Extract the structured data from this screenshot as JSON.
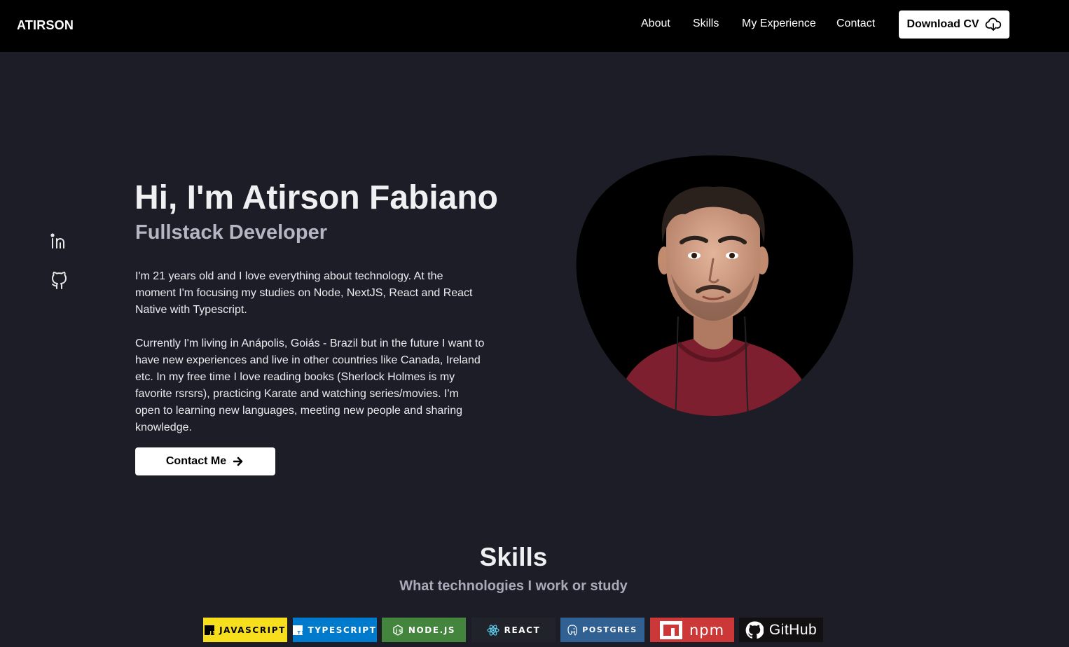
{
  "nav": {
    "brand": "ATIRSON",
    "links": [
      "About",
      "Skills",
      "My Experience",
      "Contact"
    ],
    "download_label": "Download CV"
  },
  "social": {
    "linkedin_icon": "linkedin-icon",
    "github_icon": "github-icon"
  },
  "hero": {
    "title": "Hi, I'm Atirson Fabiano",
    "subtitle": "Fullstack Developer",
    "bio_1": "I'm 21 years old and I love everything about technology. At the moment I'm focusing my studies on Node, NextJS, React and React Native with Typescript.",
    "bio_2": "Currently I'm living in Anápolis, Goiás - Brazil but in the future I want to have new experiences and live in other countries like Canada, Ireland etc. In my free time I love reading books (Sherlock Holmes is my favorite rsrsrs), practicing Karate and watching series/movies. I'm open to learning new languages, meeting new people and sharing knowledge.",
    "contact_label": "Contact Me"
  },
  "skills": {
    "title": "Skills",
    "subtitle": "What technologies I work or study",
    "badges": [
      {
        "label": "JAVASCRIPT",
        "bg": "#f7df1e",
        "fg": "#000000"
      },
      {
        "label": "TYPESCRIPT",
        "bg": "#007acc",
        "fg": "#ffffff"
      },
      {
        "label": "NODE.JS",
        "bg": "#43853d",
        "fg": "#ffffff"
      },
      {
        "label": "REACT",
        "bg": "#20232a",
        "fg": "#ffffff"
      },
      {
        "label": "POSTGRES",
        "bg": "#316192",
        "fg": "#ffffff"
      },
      {
        "label": "npm",
        "bg": "#cb3837",
        "fg": "#ffffff"
      },
      {
        "label": "GitHub",
        "bg": "#121011",
        "fg": "#ffffff"
      }
    ]
  },
  "colors": {
    "background": "#1c1d26",
    "navbar": "#000000",
    "accent_text": "#b5b5c4"
  }
}
